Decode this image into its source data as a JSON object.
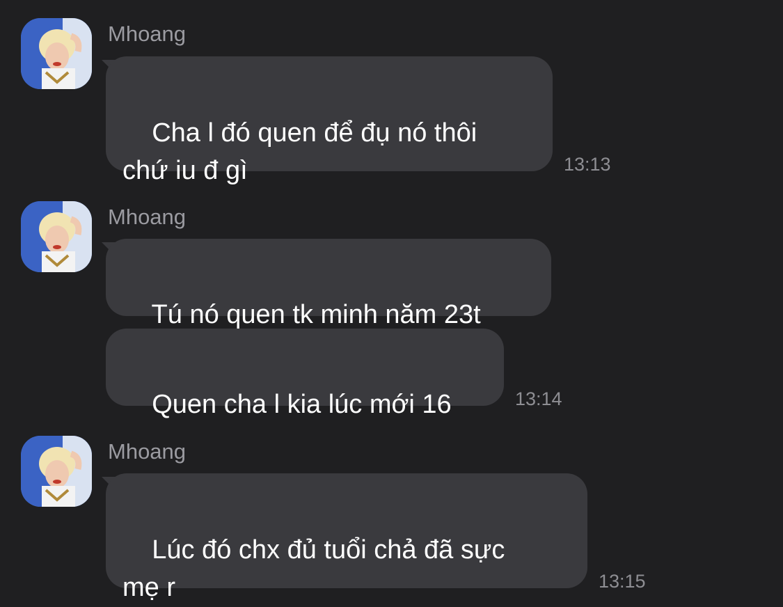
{
  "messages": [
    {
      "sender": "Mhoang",
      "bubbles": [
        "Cha l đó quen để đụ nó thôi\nchứ iu đ gì"
      ],
      "time": "13:13"
    },
    {
      "sender": "Mhoang",
      "bubbles": [
        "Tú nó quen tk minh năm 23t",
        "Quen cha l kia lúc mới 16"
      ],
      "time": "13:14"
    },
    {
      "sender": "Mhoang",
      "bubbles": [
        "Lúc đó chx đủ tuổi chả đã sực\nmẹ r"
      ],
      "time": "13:15"
    }
  ],
  "colors": {
    "background": "#1f1f21",
    "bubble": "#3a3a3e",
    "sender_name": "#9b9ba1",
    "timestamp": "#8e8e93",
    "message_text": "#ffffff"
  },
  "icons": {
    "avatar": "user-avatar-photo"
  }
}
